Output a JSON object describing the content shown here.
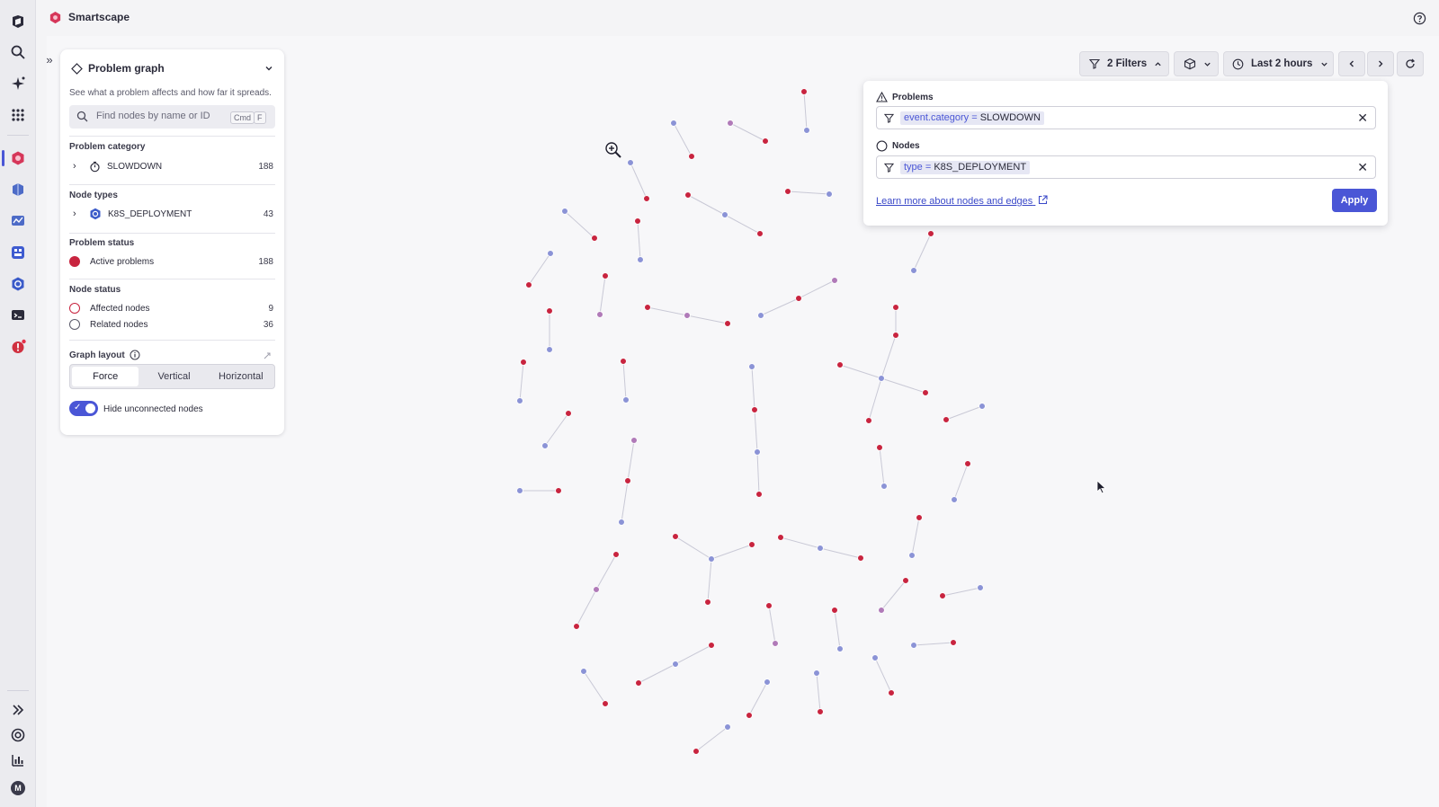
{
  "app": {
    "title": "Smartscape"
  },
  "icons": {
    "rail": [
      "dynatrace-logo-icon",
      "search-icon",
      "sparkle-icon",
      "apps-grid-icon",
      "smartscape-icon",
      "infrastructure-icon",
      "monitoring-icon",
      "dashboards-icon",
      "kubernetes-icon",
      "terminal-icon",
      "problems-icon",
      "expand-icon",
      "support-icon",
      "analytics-icon",
      "user-avatar-icon"
    ],
    "help": "help-icon"
  },
  "user": {
    "initial": "M"
  },
  "panel": {
    "title": "Problem graph",
    "description": "See what a problem affects and how far it spreads.",
    "search_placeholder": "Find nodes by name or ID",
    "shortcut_key1": "Cmd",
    "shortcut_key2": "F",
    "problem_category": {
      "label": "Problem category",
      "name": "SLOWDOWN",
      "count": "188"
    },
    "node_types": {
      "label": "Node types",
      "name": "K8S_DEPLOYMENT",
      "count": "43"
    },
    "problem_status": {
      "label": "Problem status",
      "name": "Active problems",
      "count": "188"
    },
    "node_status": {
      "label": "Node status",
      "affected": {
        "name": "Affected nodes",
        "count": "9"
      },
      "related": {
        "name": "Related nodes",
        "count": "36"
      }
    },
    "graph_layout": {
      "label": "Graph layout",
      "options": [
        "Force",
        "Vertical",
        "Horizontal"
      ],
      "selected": "Force"
    },
    "hide_unconnected_label": "Hide unconnected nodes",
    "hide_unconnected": true
  },
  "toolbar": {
    "filters_label": "2 Filters",
    "time_label": "Last 2 hours"
  },
  "filters": {
    "problems_label": "Problems",
    "problems_key": "event.category",
    "problems_op": " = ",
    "problems_value": "SLOWDOWN",
    "nodes_label": "Nodes",
    "nodes_key": "type",
    "nodes_op": " = ",
    "nodes_value": "K8S_DEPLOYMENT",
    "learn_more": "Learn more about nodes and edges",
    "apply_label": "Apply"
  },
  "colors": {
    "accent": "#4a56d6",
    "problem_node": "#c8243f",
    "entity_node": "#8b93d6",
    "mixed_node": "#b07ab8"
  }
}
